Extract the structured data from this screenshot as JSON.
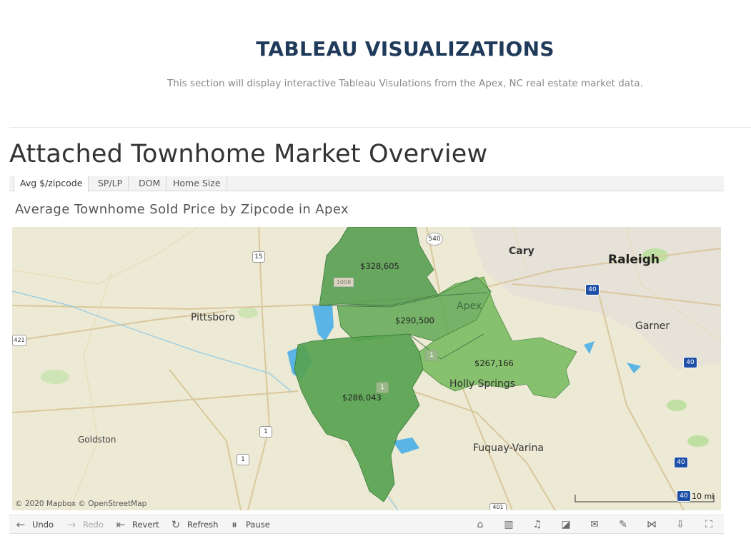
{
  "page": {
    "section_title": "TABLEAU VISUALIZATIONS",
    "section_subtitle": "This section will display interactive Tableau Visulations from the Apex, NC real estate market data.",
    "viz_heading": "Attached Townhome Market Overview"
  },
  "tabs": [
    {
      "label": "Avg $/zipcode",
      "active": true
    },
    {
      "label": "SP/LP",
      "active": false
    },
    {
      "label": "DOM",
      "active": false
    },
    {
      "label": "Home Size",
      "active": false
    }
  ],
  "viz": {
    "title": "Average Townhome Sold Price by Zipcode in Apex",
    "zip_values": [
      "$328,605",
      "$290,500",
      "$267,166",
      "$286,043"
    ],
    "cities": {
      "cary": "Cary",
      "raleigh": "Raleigh",
      "apex": "Apex",
      "pittsboro": "Pittsboro",
      "garner": "Garner",
      "holly_springs": "Holly Springs",
      "fuquay_varina": "Fuquay-Varina",
      "goldston": "Goldston"
    },
    "road_shields": {
      "r540": "540",
      "r15": "15",
      "r1008": "1008",
      "r40a": "40",
      "r40b": "40",
      "r40c": "40",
      "r40d": "40",
      "r421": "421",
      "r1a": "1",
      "r1b": "1",
      "r1c": "1",
      "r1d": "1",
      "r401": "401"
    },
    "attribution": "© 2020 Mapbox  © OpenStreetMap",
    "scale": "10 mi",
    "colors": {
      "region_dark": "#4f9a4a",
      "region_mid": "#62a956",
      "region_light": "#7cbd63",
      "water": "#5ab4e6",
      "land": "#ece9d4"
    }
  },
  "toolbar": {
    "undo": "Undo",
    "redo": "Redo",
    "revert": "Revert",
    "refresh": "Refresh",
    "pause": "Pause",
    "icons": [
      "tag-icon",
      "metrics-icon",
      "alert-icon",
      "trend-icon",
      "subscribe-icon",
      "edit-icon",
      "share-icon",
      "download-icon",
      "fullscreen-icon"
    ]
  }
}
